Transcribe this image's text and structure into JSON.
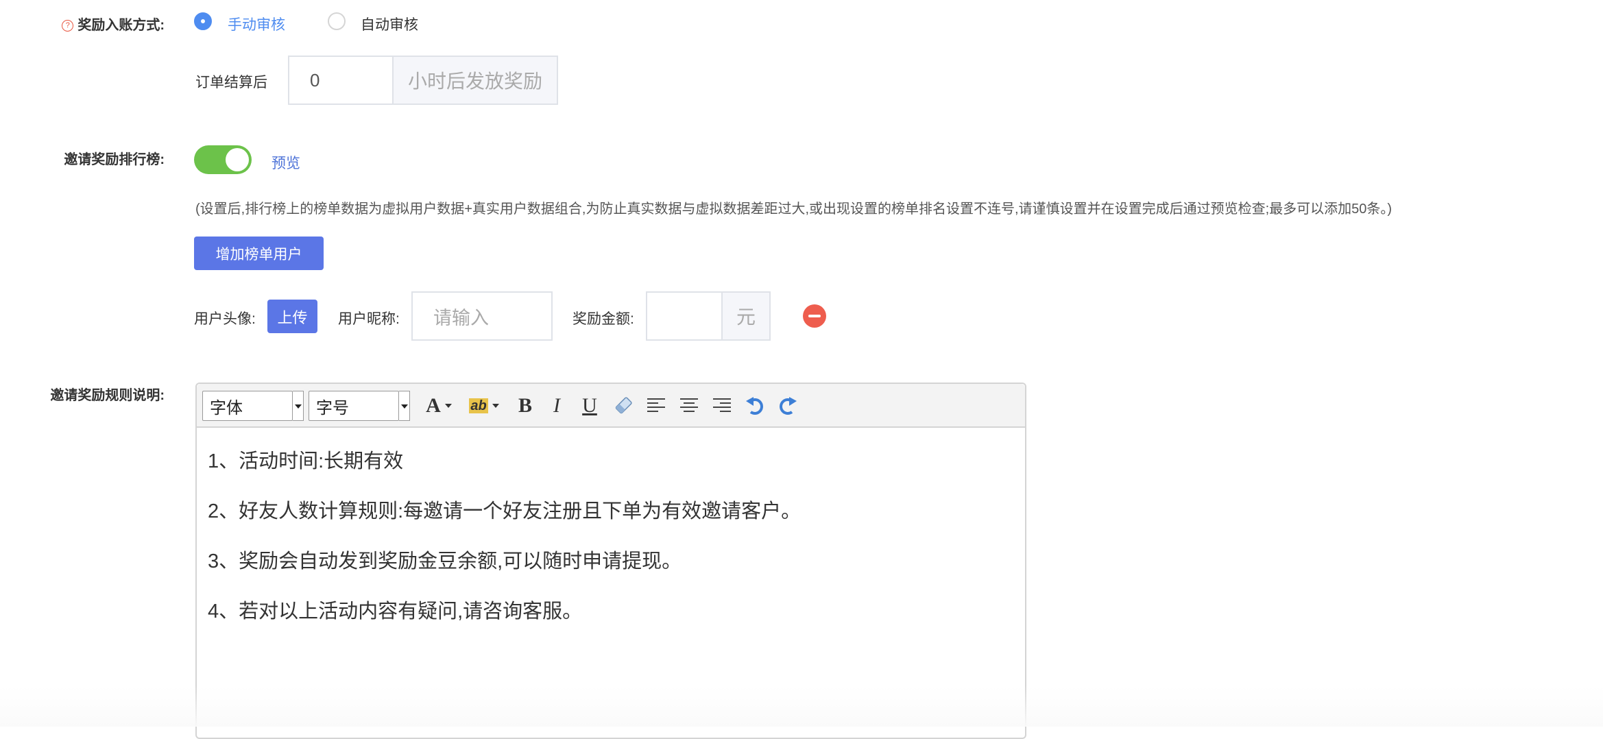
{
  "reward_method": {
    "label": "奖励入账方式:",
    "help_icon": "?",
    "options": [
      {
        "label": "手动审核",
        "selected": true
      },
      {
        "label": "自动审核",
        "selected": false
      }
    ]
  },
  "settlement": {
    "prefix": "订单结算后",
    "value": "0",
    "suffix": "小时后发放奖励"
  },
  "ranking": {
    "label": "邀请奖励排行榜:",
    "enabled": true,
    "preview_link": "预览",
    "note": "(设置后,排行榜上的榜单数据为虚拟用户数据+真实用户数据组合,为防止真实数据与虚拟数据差距过大,或出现设置的榜单排名设置不连号,请谨慎设置并在设置完成后通过预览检查;最多可以添加50条。)",
    "add_button": "增加榜单用户",
    "row": {
      "avatar_label": "用户头像:",
      "upload_button": "上传",
      "nickname_label": "用户昵称:",
      "nickname_placeholder": "请输入",
      "amount_label": "奖励金额:",
      "amount_unit": "元"
    }
  },
  "rules": {
    "label": "邀请奖励规则说明:",
    "toolbar": {
      "font_family": "字体",
      "font_size": "字号",
      "font_color_glyph": "A",
      "highlight_glyph": "ab",
      "bold_glyph": "B",
      "italic_glyph": "I",
      "underline_glyph": "U"
    },
    "content": [
      "1、活动时间:长期有效",
      "2、好友人数计算规则:每邀请一个好友注册且下单为有效邀请客户。",
      "3、奖励会自动发到奖励金豆余额,可以随时申请提现。",
      "4、若对以上活动内容有疑问,请咨询客服。"
    ]
  },
  "colors": {
    "primary": "#5b76e6",
    "radio_blue": "#4e8cf0",
    "switch_green": "#6cc24a",
    "danger": "#ee5d4e"
  }
}
